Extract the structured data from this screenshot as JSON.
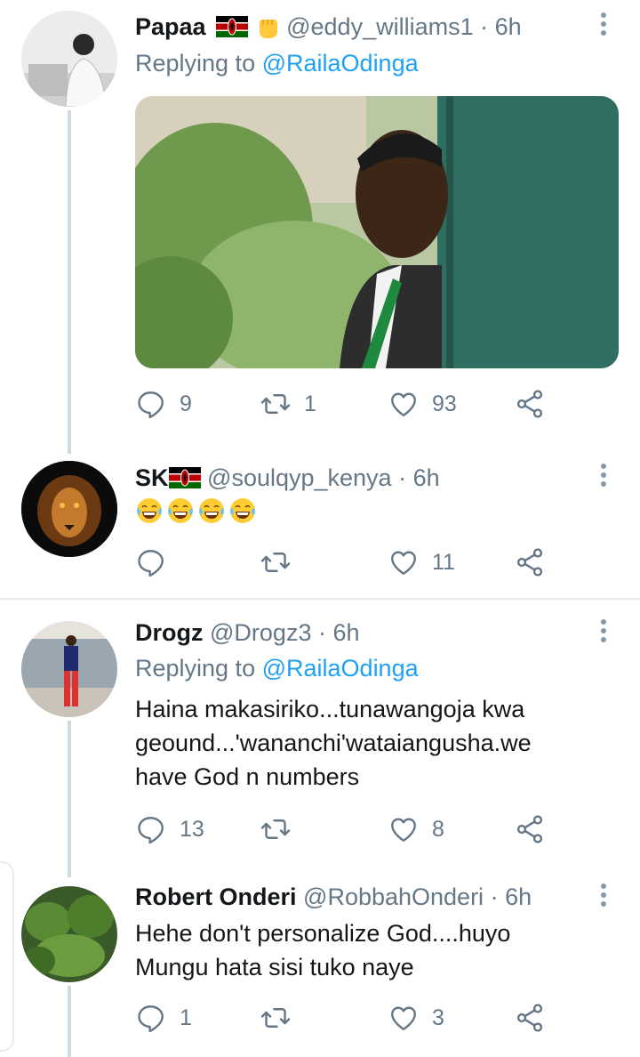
{
  "colors": {
    "accent": "#1da1f2",
    "muted": "#657786",
    "text": "#14171a",
    "line": "#cfd9de"
  },
  "tweets": [
    {
      "name": "Papaa",
      "handle": "@eddy_williams1",
      "time": "· 6h",
      "replying_prefix": "Replying to",
      "replying_to": "@RailaOdinga",
      "has_flag": true,
      "has_fist": true,
      "media": "photo of man in suit peeking from behind green door",
      "replies": "9",
      "retweets": "1",
      "likes": "93"
    },
    {
      "name": "SK",
      "handle": "@soulqyp_kenya",
      "time": "· 6h",
      "has_flag": true,
      "body": "😂😂😂😂",
      "replies": "",
      "retweets": "",
      "likes": "11"
    },
    {
      "name": "Drogz",
      "handle": "@Drogz3",
      "time": "· 6h",
      "replying_prefix": "Replying to",
      "replying_to": "@RailaOdinga",
      "body": "Haina makasiriko...tunawangoja kwa geound...'wananchi'wataiangusha.we have God n numbers",
      "replies": "13",
      "retweets": "",
      "likes": "8"
    },
    {
      "name": "Robert Onderi",
      "handle": "@RobbahOnderi",
      "time": "· 6h",
      "body": "Hehe don't personalize God....huyo Mungu hata sisi tuko naye",
      "replies": "1",
      "retweets": "",
      "likes": "3"
    }
  ],
  "icons": [
    "reply-icon",
    "retweet-icon",
    "like-icon",
    "share-icon",
    "more-icon"
  ]
}
